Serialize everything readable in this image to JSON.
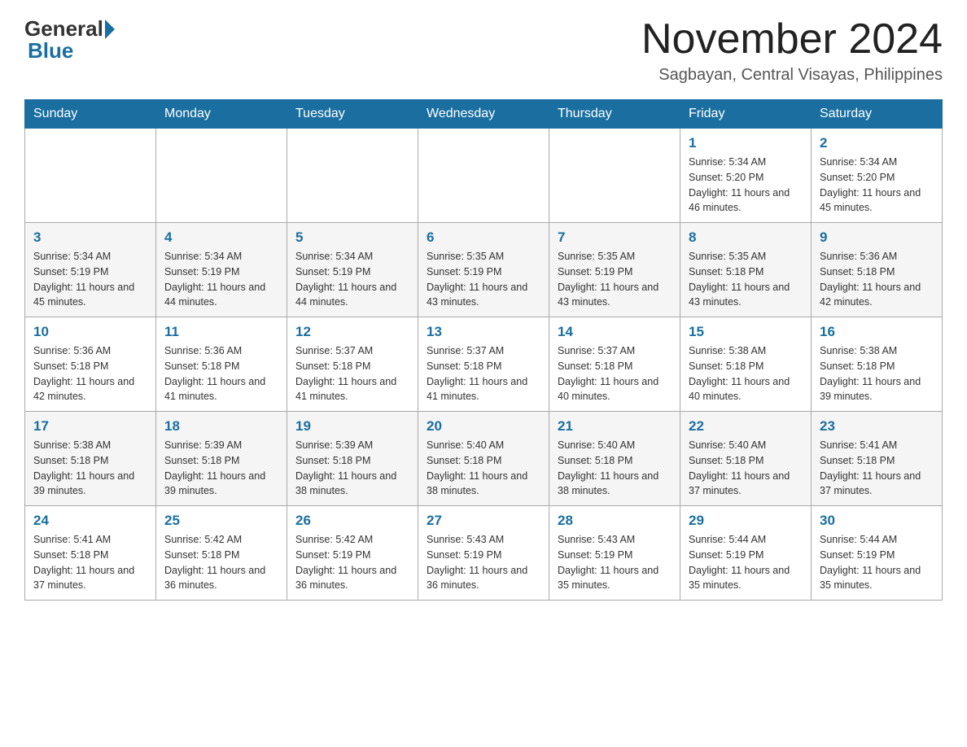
{
  "logo": {
    "general": "General",
    "blue": "Blue"
  },
  "header": {
    "month_year": "November 2024",
    "location": "Sagbayan, Central Visayas, Philippines"
  },
  "days_of_week": [
    "Sunday",
    "Monday",
    "Tuesday",
    "Wednesday",
    "Thursday",
    "Friday",
    "Saturday"
  ],
  "weeks": [
    [
      {
        "day": "",
        "info": ""
      },
      {
        "day": "",
        "info": ""
      },
      {
        "day": "",
        "info": ""
      },
      {
        "day": "",
        "info": ""
      },
      {
        "day": "",
        "info": ""
      },
      {
        "day": "1",
        "info": "Sunrise: 5:34 AM\nSunset: 5:20 PM\nDaylight: 11 hours and 46 minutes."
      },
      {
        "day": "2",
        "info": "Sunrise: 5:34 AM\nSunset: 5:20 PM\nDaylight: 11 hours and 45 minutes."
      }
    ],
    [
      {
        "day": "3",
        "info": "Sunrise: 5:34 AM\nSunset: 5:19 PM\nDaylight: 11 hours and 45 minutes."
      },
      {
        "day": "4",
        "info": "Sunrise: 5:34 AM\nSunset: 5:19 PM\nDaylight: 11 hours and 44 minutes."
      },
      {
        "day": "5",
        "info": "Sunrise: 5:34 AM\nSunset: 5:19 PM\nDaylight: 11 hours and 44 minutes."
      },
      {
        "day": "6",
        "info": "Sunrise: 5:35 AM\nSunset: 5:19 PM\nDaylight: 11 hours and 43 minutes."
      },
      {
        "day": "7",
        "info": "Sunrise: 5:35 AM\nSunset: 5:19 PM\nDaylight: 11 hours and 43 minutes."
      },
      {
        "day": "8",
        "info": "Sunrise: 5:35 AM\nSunset: 5:18 PM\nDaylight: 11 hours and 43 minutes."
      },
      {
        "day": "9",
        "info": "Sunrise: 5:36 AM\nSunset: 5:18 PM\nDaylight: 11 hours and 42 minutes."
      }
    ],
    [
      {
        "day": "10",
        "info": "Sunrise: 5:36 AM\nSunset: 5:18 PM\nDaylight: 11 hours and 42 minutes."
      },
      {
        "day": "11",
        "info": "Sunrise: 5:36 AM\nSunset: 5:18 PM\nDaylight: 11 hours and 41 minutes."
      },
      {
        "day": "12",
        "info": "Sunrise: 5:37 AM\nSunset: 5:18 PM\nDaylight: 11 hours and 41 minutes."
      },
      {
        "day": "13",
        "info": "Sunrise: 5:37 AM\nSunset: 5:18 PM\nDaylight: 11 hours and 41 minutes."
      },
      {
        "day": "14",
        "info": "Sunrise: 5:37 AM\nSunset: 5:18 PM\nDaylight: 11 hours and 40 minutes."
      },
      {
        "day": "15",
        "info": "Sunrise: 5:38 AM\nSunset: 5:18 PM\nDaylight: 11 hours and 40 minutes."
      },
      {
        "day": "16",
        "info": "Sunrise: 5:38 AM\nSunset: 5:18 PM\nDaylight: 11 hours and 39 minutes."
      }
    ],
    [
      {
        "day": "17",
        "info": "Sunrise: 5:38 AM\nSunset: 5:18 PM\nDaylight: 11 hours and 39 minutes."
      },
      {
        "day": "18",
        "info": "Sunrise: 5:39 AM\nSunset: 5:18 PM\nDaylight: 11 hours and 39 minutes."
      },
      {
        "day": "19",
        "info": "Sunrise: 5:39 AM\nSunset: 5:18 PM\nDaylight: 11 hours and 38 minutes."
      },
      {
        "day": "20",
        "info": "Sunrise: 5:40 AM\nSunset: 5:18 PM\nDaylight: 11 hours and 38 minutes."
      },
      {
        "day": "21",
        "info": "Sunrise: 5:40 AM\nSunset: 5:18 PM\nDaylight: 11 hours and 38 minutes."
      },
      {
        "day": "22",
        "info": "Sunrise: 5:40 AM\nSunset: 5:18 PM\nDaylight: 11 hours and 37 minutes."
      },
      {
        "day": "23",
        "info": "Sunrise: 5:41 AM\nSunset: 5:18 PM\nDaylight: 11 hours and 37 minutes."
      }
    ],
    [
      {
        "day": "24",
        "info": "Sunrise: 5:41 AM\nSunset: 5:18 PM\nDaylight: 11 hours and 37 minutes."
      },
      {
        "day": "25",
        "info": "Sunrise: 5:42 AM\nSunset: 5:18 PM\nDaylight: 11 hours and 36 minutes."
      },
      {
        "day": "26",
        "info": "Sunrise: 5:42 AM\nSunset: 5:19 PM\nDaylight: 11 hours and 36 minutes."
      },
      {
        "day": "27",
        "info": "Sunrise: 5:43 AM\nSunset: 5:19 PM\nDaylight: 11 hours and 36 minutes."
      },
      {
        "day": "28",
        "info": "Sunrise: 5:43 AM\nSunset: 5:19 PM\nDaylight: 11 hours and 35 minutes."
      },
      {
        "day": "29",
        "info": "Sunrise: 5:44 AM\nSunset: 5:19 PM\nDaylight: 11 hours and 35 minutes."
      },
      {
        "day": "30",
        "info": "Sunrise: 5:44 AM\nSunset: 5:19 PM\nDaylight: 11 hours and 35 minutes."
      }
    ]
  ]
}
